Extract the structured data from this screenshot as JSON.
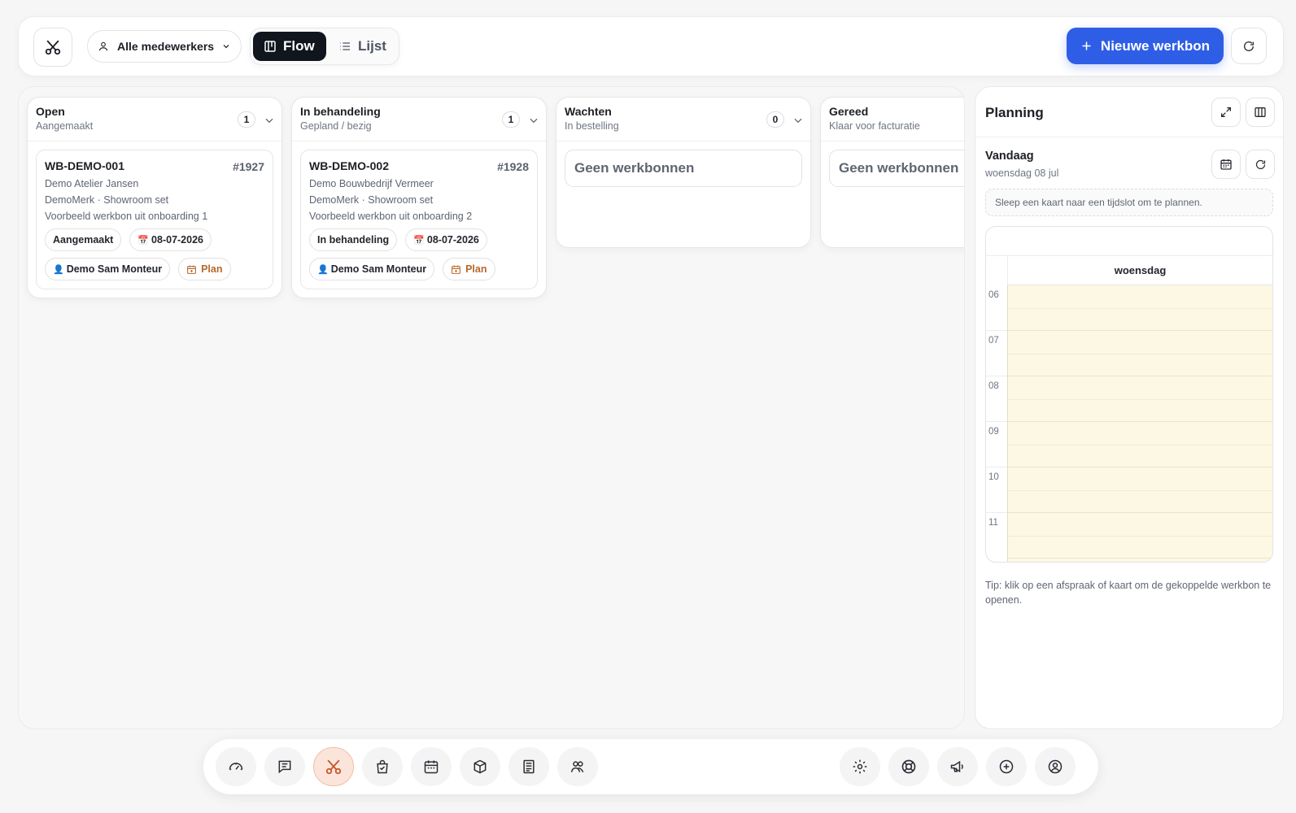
{
  "toolbar": {
    "logo_icon": "scissors-tools-icon",
    "employee_filter": "Alle medewerkers",
    "view_flow": "Flow",
    "view_list": "Lijst",
    "new_label": "Nieuwe werkbon",
    "accent": "#2f5ee6"
  },
  "columns": [
    {
      "title": "Open",
      "subtitle": "Aangemaakt",
      "count": "1",
      "card": {
        "id": "WB-DEMO-001",
        "number": "#1927",
        "customer": "Demo Atelier Jansen",
        "product": "DemoMerk · Showroom set",
        "description": "Voorbeeld werkbon uit onboarding 1",
        "status": "Aangemaakt",
        "date": "08-07-2026",
        "assignee": "Demo Sam Monteur",
        "plan": "Plan"
      }
    },
    {
      "title": "In behandeling",
      "subtitle": "Gepland / bezig",
      "count": "1",
      "card": {
        "id": "WB-DEMO-002",
        "number": "#1928",
        "customer": "Demo Bouwbedrijf Vermeer",
        "product": "DemoMerk · Showroom set",
        "description": "Voorbeeld werkbon uit onboarding 2",
        "status": "In behandeling",
        "date": "08-07-2026",
        "assignee": "Demo Sam Monteur",
        "plan": "Plan"
      }
    },
    {
      "title": "Wachten",
      "subtitle": "In bestelling",
      "count": "0",
      "empty": "Geen werkbonnen"
    },
    {
      "title": "Gereed",
      "subtitle": "Klaar voor facturatie",
      "empty": "Geen werkbonnen"
    }
  ],
  "planning": {
    "title": "Planning",
    "today_title": "Vandaag",
    "today_date": "woensdag 08 jul",
    "drag_hint": "Sleep een kaart naar een tijdslot om te plannen.",
    "day_label": "woensdag",
    "hours": [
      "06",
      "07",
      "08",
      "09",
      "10",
      "11"
    ],
    "tip": "Tip: klik op een afspraak of kaart om de gekoppelde werkbon te openen.",
    "slot_color": "#fdf8e4"
  },
  "dock": {
    "left_items": [
      "dashboard-icon",
      "messages-icon",
      "workorders-icon",
      "tasks-icon",
      "calendar-icon",
      "products-icon",
      "invoices-icon",
      "customers-icon"
    ],
    "right_items": [
      "settings-icon",
      "support-icon",
      "announcements-icon",
      "add-icon",
      "account-icon"
    ],
    "active": "workorders-icon",
    "active_color": "#fbe5da"
  }
}
